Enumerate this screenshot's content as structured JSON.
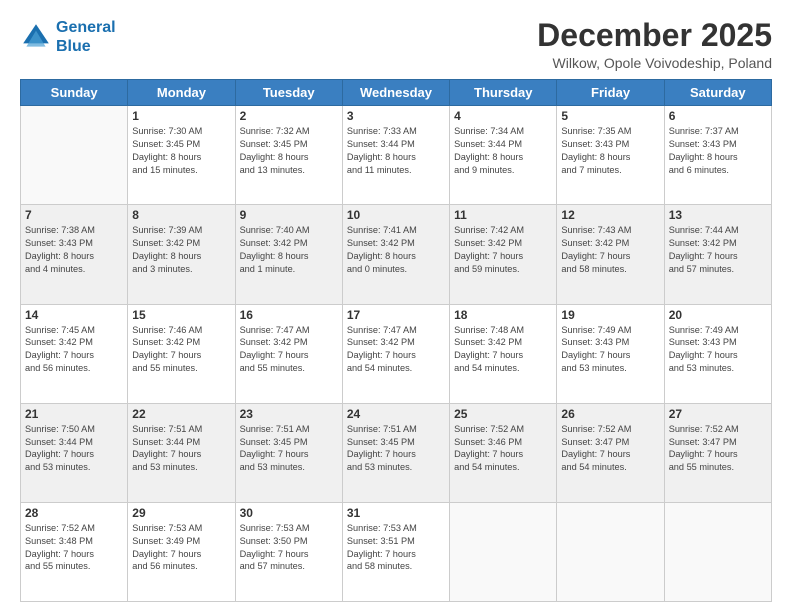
{
  "header": {
    "logo_line1": "General",
    "logo_line2": "Blue",
    "title": "December 2025",
    "subtitle": "Wilkow, Opole Voivodeship, Poland"
  },
  "days_of_week": [
    "Sunday",
    "Monday",
    "Tuesday",
    "Wednesday",
    "Thursday",
    "Friday",
    "Saturday"
  ],
  "weeks": [
    [
      {
        "day": "",
        "content": ""
      },
      {
        "day": "1",
        "content": "Sunrise: 7:30 AM\nSunset: 3:45 PM\nDaylight: 8 hours\nand 15 minutes."
      },
      {
        "day": "2",
        "content": "Sunrise: 7:32 AM\nSunset: 3:45 PM\nDaylight: 8 hours\nand 13 minutes."
      },
      {
        "day": "3",
        "content": "Sunrise: 7:33 AM\nSunset: 3:44 PM\nDaylight: 8 hours\nand 11 minutes."
      },
      {
        "day": "4",
        "content": "Sunrise: 7:34 AM\nSunset: 3:44 PM\nDaylight: 8 hours\nand 9 minutes."
      },
      {
        "day": "5",
        "content": "Sunrise: 7:35 AM\nSunset: 3:43 PM\nDaylight: 8 hours\nand 7 minutes."
      },
      {
        "day": "6",
        "content": "Sunrise: 7:37 AM\nSunset: 3:43 PM\nDaylight: 8 hours\nand 6 minutes."
      }
    ],
    [
      {
        "day": "7",
        "content": "Sunrise: 7:38 AM\nSunset: 3:43 PM\nDaylight: 8 hours\nand 4 minutes."
      },
      {
        "day": "8",
        "content": "Sunrise: 7:39 AM\nSunset: 3:42 PM\nDaylight: 8 hours\nand 3 minutes."
      },
      {
        "day": "9",
        "content": "Sunrise: 7:40 AM\nSunset: 3:42 PM\nDaylight: 8 hours\nand 1 minute."
      },
      {
        "day": "10",
        "content": "Sunrise: 7:41 AM\nSunset: 3:42 PM\nDaylight: 8 hours\nand 0 minutes."
      },
      {
        "day": "11",
        "content": "Sunrise: 7:42 AM\nSunset: 3:42 PM\nDaylight: 7 hours\nand 59 minutes."
      },
      {
        "day": "12",
        "content": "Sunrise: 7:43 AM\nSunset: 3:42 PM\nDaylight: 7 hours\nand 58 minutes."
      },
      {
        "day": "13",
        "content": "Sunrise: 7:44 AM\nSunset: 3:42 PM\nDaylight: 7 hours\nand 57 minutes."
      }
    ],
    [
      {
        "day": "14",
        "content": "Sunrise: 7:45 AM\nSunset: 3:42 PM\nDaylight: 7 hours\nand 56 minutes."
      },
      {
        "day": "15",
        "content": "Sunrise: 7:46 AM\nSunset: 3:42 PM\nDaylight: 7 hours\nand 55 minutes."
      },
      {
        "day": "16",
        "content": "Sunrise: 7:47 AM\nSunset: 3:42 PM\nDaylight: 7 hours\nand 55 minutes."
      },
      {
        "day": "17",
        "content": "Sunrise: 7:47 AM\nSunset: 3:42 PM\nDaylight: 7 hours\nand 54 minutes."
      },
      {
        "day": "18",
        "content": "Sunrise: 7:48 AM\nSunset: 3:42 PM\nDaylight: 7 hours\nand 54 minutes."
      },
      {
        "day": "19",
        "content": "Sunrise: 7:49 AM\nSunset: 3:43 PM\nDaylight: 7 hours\nand 53 minutes."
      },
      {
        "day": "20",
        "content": "Sunrise: 7:49 AM\nSunset: 3:43 PM\nDaylight: 7 hours\nand 53 minutes."
      }
    ],
    [
      {
        "day": "21",
        "content": "Sunrise: 7:50 AM\nSunset: 3:44 PM\nDaylight: 7 hours\nand 53 minutes."
      },
      {
        "day": "22",
        "content": "Sunrise: 7:51 AM\nSunset: 3:44 PM\nDaylight: 7 hours\nand 53 minutes."
      },
      {
        "day": "23",
        "content": "Sunrise: 7:51 AM\nSunset: 3:45 PM\nDaylight: 7 hours\nand 53 minutes."
      },
      {
        "day": "24",
        "content": "Sunrise: 7:51 AM\nSunset: 3:45 PM\nDaylight: 7 hours\nand 53 minutes."
      },
      {
        "day": "25",
        "content": "Sunrise: 7:52 AM\nSunset: 3:46 PM\nDaylight: 7 hours\nand 54 minutes."
      },
      {
        "day": "26",
        "content": "Sunrise: 7:52 AM\nSunset: 3:47 PM\nDaylight: 7 hours\nand 54 minutes."
      },
      {
        "day": "27",
        "content": "Sunrise: 7:52 AM\nSunset: 3:47 PM\nDaylight: 7 hours\nand 55 minutes."
      }
    ],
    [
      {
        "day": "28",
        "content": "Sunrise: 7:52 AM\nSunset: 3:48 PM\nDaylight: 7 hours\nand 55 minutes."
      },
      {
        "day": "29",
        "content": "Sunrise: 7:53 AM\nSunset: 3:49 PM\nDaylight: 7 hours\nand 56 minutes."
      },
      {
        "day": "30",
        "content": "Sunrise: 7:53 AM\nSunset: 3:50 PM\nDaylight: 7 hours\nand 57 minutes."
      },
      {
        "day": "31",
        "content": "Sunrise: 7:53 AM\nSunset: 3:51 PM\nDaylight: 7 hours\nand 58 minutes."
      },
      {
        "day": "",
        "content": ""
      },
      {
        "day": "",
        "content": ""
      },
      {
        "day": "",
        "content": ""
      }
    ]
  ]
}
